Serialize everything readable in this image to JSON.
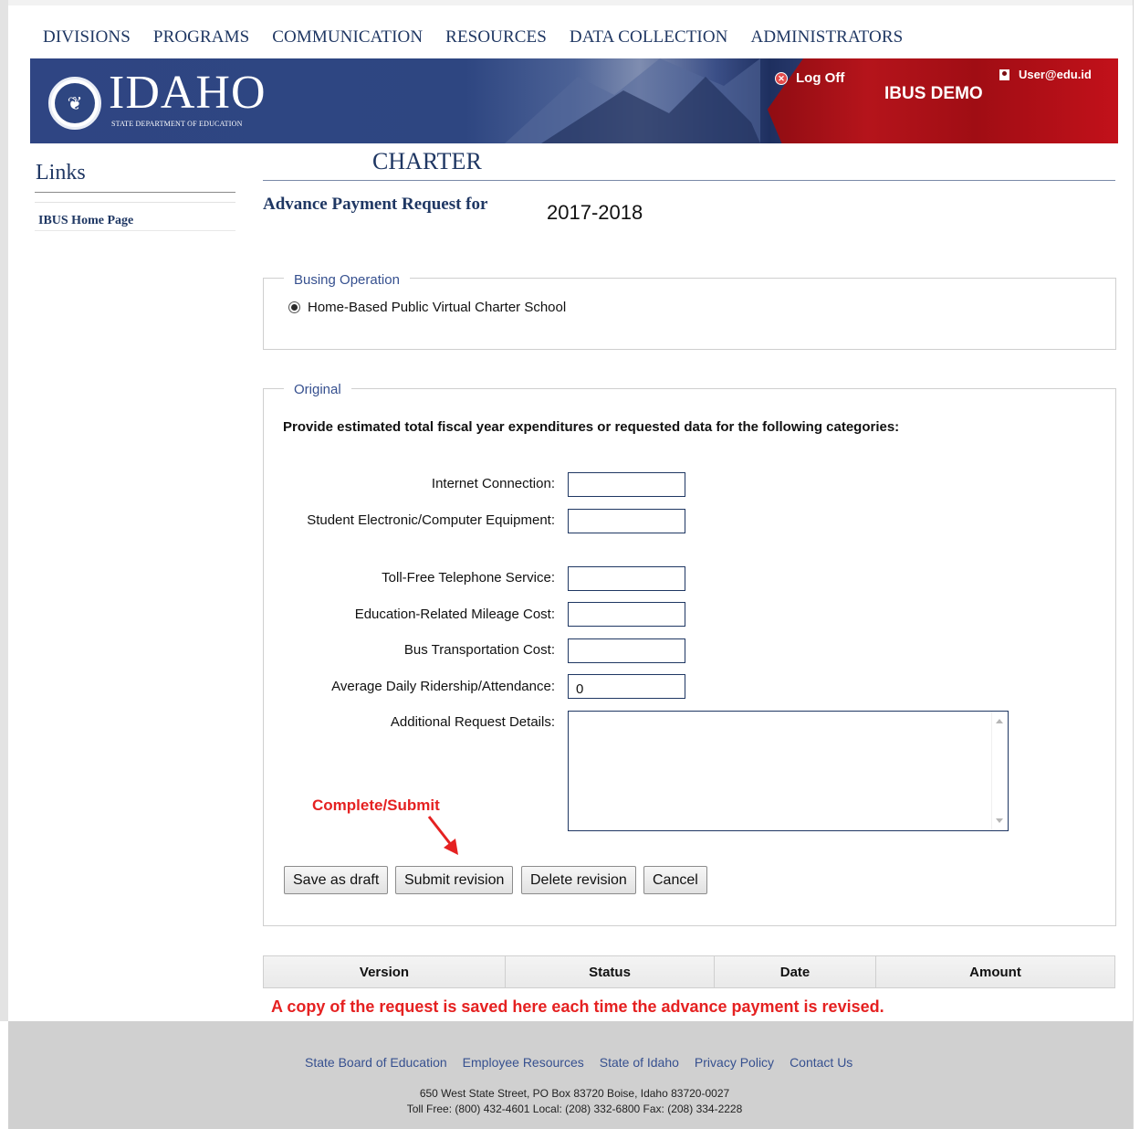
{
  "topnav": [
    "DIVISIONS",
    "PROGRAMS",
    "COMMUNICATION",
    "RESOURCES",
    "DATA COLLECTION",
    "ADMINISTRATORS"
  ],
  "banner": {
    "logo_word": "IDAHO",
    "logo_sub": "STATE DEPARTMENT OF EDUCATION",
    "logoff_label": "Log Off",
    "user_label": "User@edu.id",
    "app_name": "IBUS DEMO"
  },
  "sidebar": {
    "title": "Links",
    "items": [
      "IBUS Home Page"
    ]
  },
  "main": {
    "page_title": "CHARTER",
    "request_label": "Advance Payment Request for",
    "year": "2017-2018"
  },
  "busing": {
    "legend": "Busing Operation",
    "option": "Home-Based Public Virtual Charter School",
    "selected": true
  },
  "original": {
    "legend": "Original",
    "instructions": "Provide estimated total fiscal year expenditures or requested data for the following categories:",
    "fields": {
      "internet": {
        "label": "Internet Connection:",
        "value": ""
      },
      "equipment": {
        "label": "Student Electronic/Computer Equipment:",
        "value": ""
      },
      "telephone": {
        "label": "Toll-Free Telephone Service:",
        "value": ""
      },
      "mileage": {
        "label": "Education-Related Mileage Cost:",
        "value": ""
      },
      "bus": {
        "label": "Bus Transportation Cost:",
        "value": ""
      },
      "ridership": {
        "label": "Average Daily Ridership/Attendance:",
        "value": "0"
      },
      "details": {
        "label": "Additional Request Details:",
        "value": ""
      }
    },
    "buttons": {
      "save": "Save as draft",
      "submit": "Submit revision",
      "delete": "Delete revision",
      "cancel": "Cancel"
    }
  },
  "annotations": {
    "complete": "Complete/Submit",
    "copy_note": "A copy of the request is saved here each time the advance payment is revised.",
    "color": "#e52121"
  },
  "history_table": {
    "columns": [
      "Version",
      "Status",
      "Date",
      "Amount"
    ]
  },
  "footer": {
    "links": [
      "State Board of Education",
      "Employee Resources",
      "State of Idaho",
      "Privacy Policy",
      "Contact Us"
    ],
    "address": "650 West State Street, PO Box 83720 Boise, Idaho 83720-0027",
    "phones": "Toll Free: (800) 432-4601 Local: (208) 332-6800 Fax: (208) 334-2228"
  },
  "colors": {
    "navy": "#1f3763",
    "link_blue": "#36508f",
    "banner_red": "#b5141b"
  }
}
